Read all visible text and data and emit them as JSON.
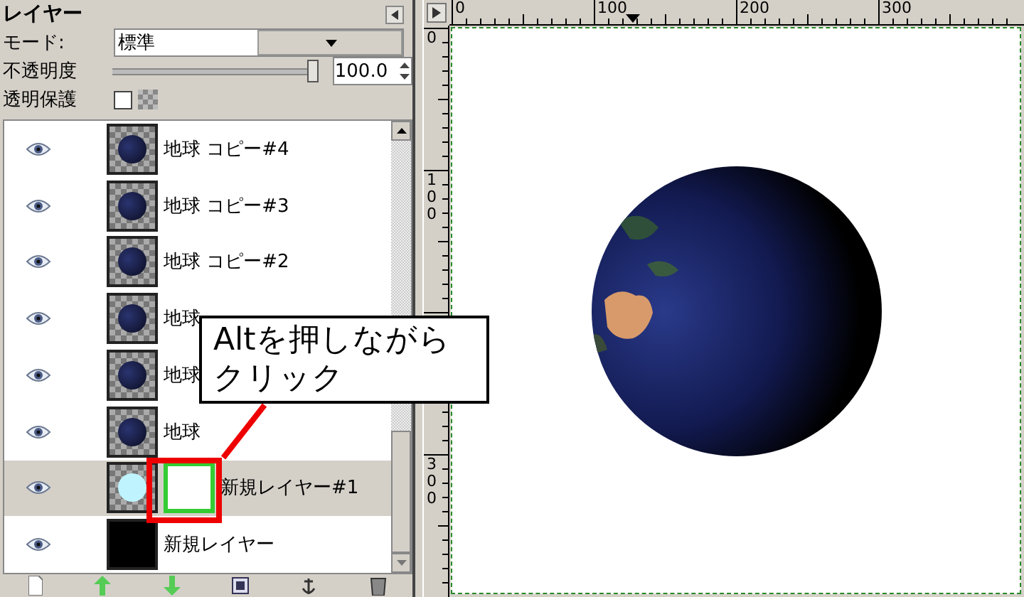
{
  "panel": {
    "title": "レイヤー",
    "mode_label": "モード:",
    "mode_value": "標準",
    "opacity_label": "不透明度",
    "opacity": {
      "level": 1.0
    },
    "opacity_value": "100.0",
    "lock_label": "透明保護",
    "lock_alpha": false
  },
  "layers": [
    {
      "name": "地球 コピー#4",
      "kind": "earth",
      "visible": true,
      "selected": false
    },
    {
      "name": "地球 コピー#3",
      "kind": "earth",
      "visible": true,
      "selected": false
    },
    {
      "name": "地球 コピー#2",
      "kind": "earth",
      "visible": true,
      "selected": false
    },
    {
      "name": "地球",
      "kind": "earth",
      "visible": true,
      "selected": false
    },
    {
      "name": "地球",
      "kind": "earth",
      "visible": true,
      "selected": false
    },
    {
      "name": "地球",
      "kind": "earth",
      "visible": true,
      "selected": false
    },
    {
      "name": "新規レイヤー#1",
      "kind": "glow",
      "visible": true,
      "selected": true,
      "mask": {
        "active": true
      }
    },
    {
      "name": "新規レイヤー",
      "kind": "fill",
      "visible": true,
      "selected": false
    }
  ],
  "canvas": {
    "h_ruler": [
      "0",
      "100",
      "200",
      "300"
    ],
    "v_ruler_upper": [
      "0",
      "100"
    ],
    "v_ruler_lower": [
      "300"
    ]
  },
  "callout": {
    "lines": [
      "Altを押しながら",
      "クリック"
    ]
  }
}
